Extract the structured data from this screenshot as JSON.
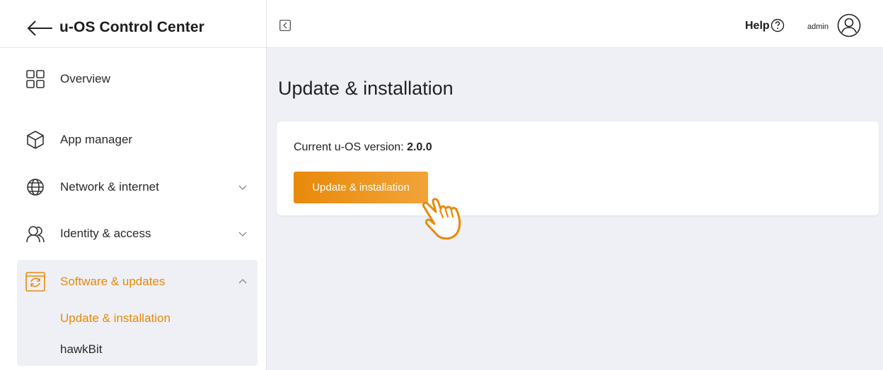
{
  "header": {
    "title": "u-OS Control Center"
  },
  "sidebar": {
    "items": [
      {
        "label": "Overview",
        "icon": "grid-icon"
      },
      {
        "label": "App manager",
        "icon": "cube-icon"
      },
      {
        "label": "Network & internet",
        "icon": "globe-icon",
        "expandable": true
      },
      {
        "label": "Identity & access",
        "icon": "users-icon",
        "expandable": true
      },
      {
        "label": "Software & updates",
        "icon": "refresh-icon",
        "expanded": true,
        "subitems": [
          {
            "label": "Update & installation",
            "active": true
          },
          {
            "label": "hawkBit"
          }
        ]
      }
    ]
  },
  "topbar": {
    "help": "Help",
    "user": "admin"
  },
  "page": {
    "title": "Update & installation",
    "version_label": "Current u-OS version:",
    "version_value": "2.0.0",
    "button_label": "Update & installation"
  },
  "colors": {
    "accent": "#e8890a",
    "background": "#eff0f5"
  }
}
